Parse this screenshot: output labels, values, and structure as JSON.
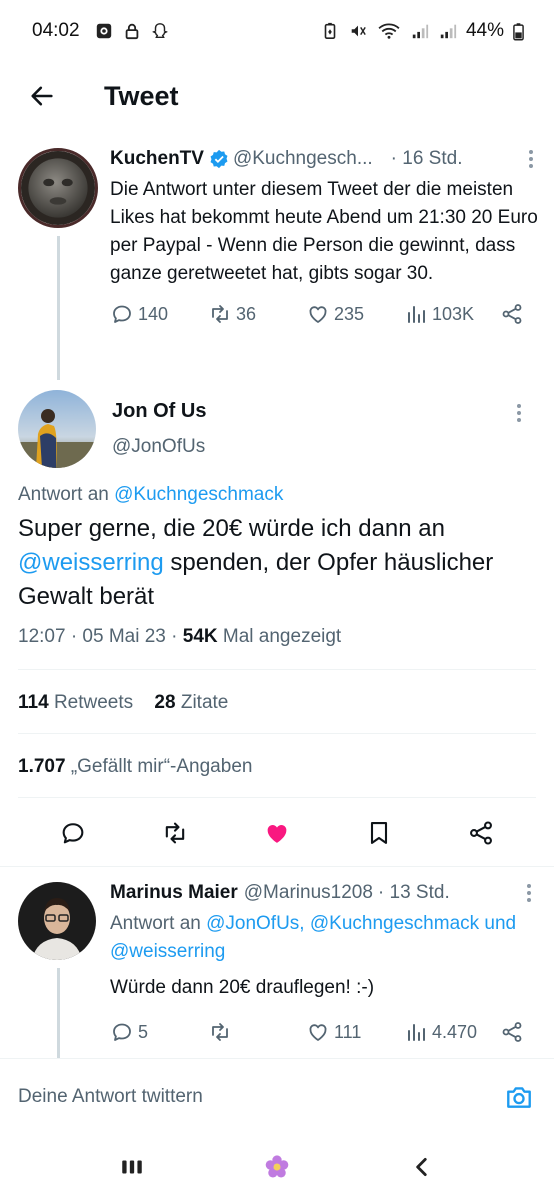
{
  "status_bar": {
    "time": "04:02",
    "battery": "44%"
  },
  "header": {
    "title": "Tweet"
  },
  "parent_tweet": {
    "name": "KuchenTV",
    "handle": "@Kuchngesch...",
    "time": "· 16 Std.",
    "text": "Die Antwort unter diesem Tweet der die meisten Likes hat bekommt heute Abend um 21:30 20 Euro per Paypal - Wenn die Person die gewinnt, dass ganze geretweetet hat, gibts sogar 30.",
    "replies": "140",
    "retweets": "36",
    "likes": "235",
    "views": "103K"
  },
  "main_tweet": {
    "name": "Jon Of Us",
    "handle": "@JonOfUs",
    "reply_prefix": "Antwort an",
    "reply_handle": "@Kuchngeschmack",
    "text_part1": "Super gerne, die 20€ würde ich dann an ",
    "text_mention": "@weisserring",
    "text_part2": " spenden, der Opfer häuslicher Gewalt berät",
    "timestamp": "12:07 · 05 Mai 23 · ",
    "views_count": "54K",
    "views_label": "Mal angezeigt",
    "retweets_count": "114",
    "retweets_label": "Retweets",
    "quotes_count": "28",
    "quotes_label": "Zitate",
    "likes_count": "1.707",
    "likes_label": "„Gefällt mir“-Angaben"
  },
  "reply_tweet": {
    "name": "Marinus Maier",
    "handle": "@Marinus1208",
    "time": "· 13 Std.",
    "reply_prefix": "Antwort an",
    "reply_handle1": "@JonOfUs,",
    "reply_handle2": "@Kuchngeschmack",
    "reply_and": "und",
    "reply_handle3": "@weisserring",
    "text": "Würde dann 20€ drauflegen! :-)",
    "replies": "5",
    "likes": "111",
    "views": "4.470"
  },
  "compose": {
    "placeholder": "Deine Antwort twittern"
  },
  "colors": {
    "accent": "#1d9bf0",
    "like": "#f91880",
    "text": "#0f1419",
    "muted": "#536471"
  }
}
